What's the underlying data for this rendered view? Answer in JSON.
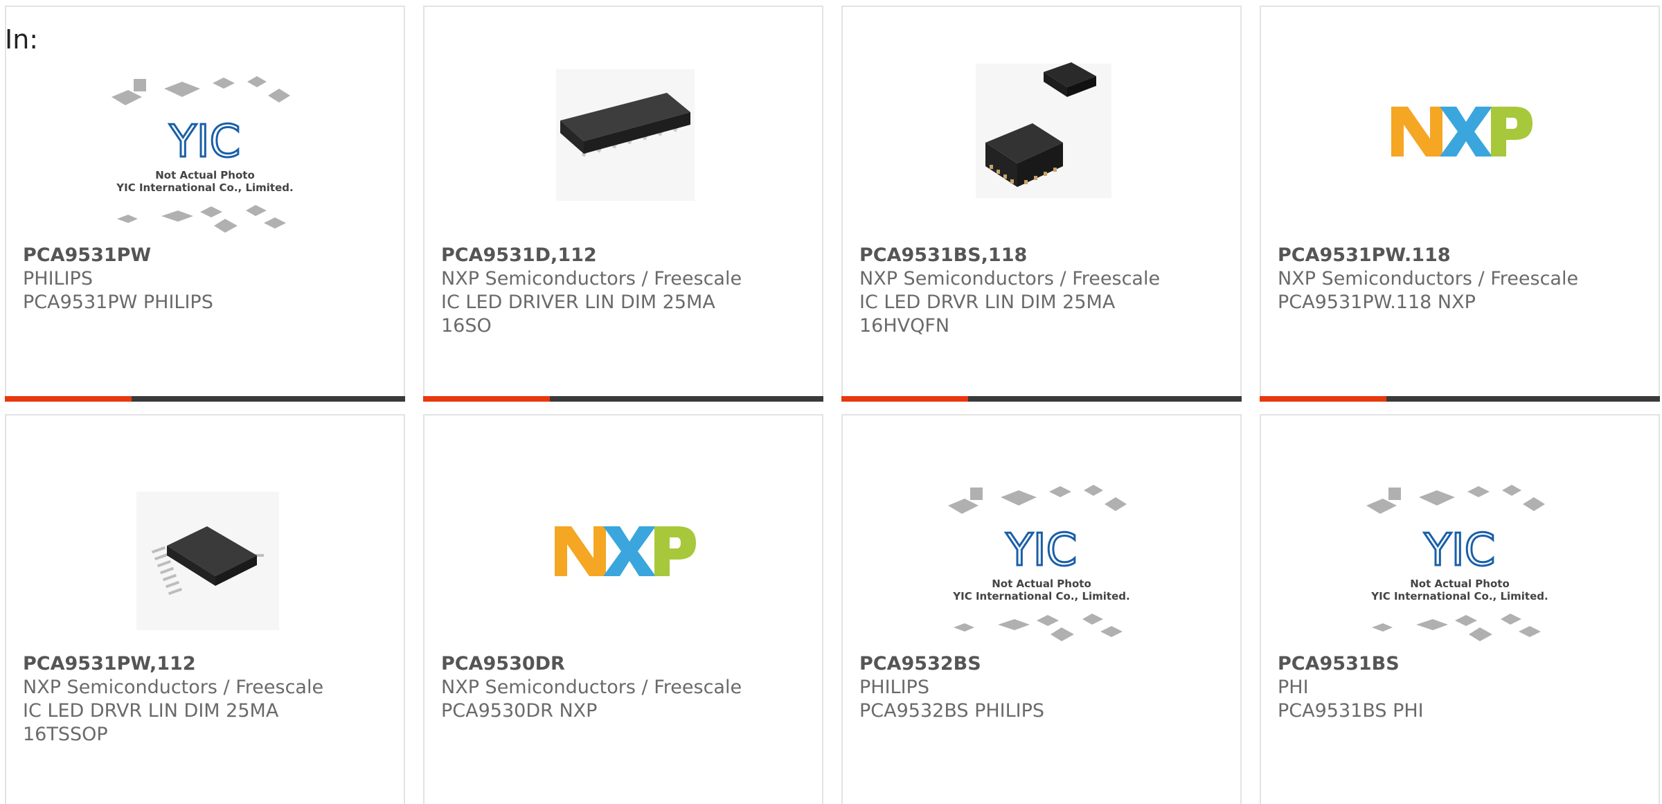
{
  "header": {
    "in_label": "In:"
  },
  "colors": {
    "accent": "#e8380d",
    "bar": "#3a3a3a",
    "border": "#e3e3e3",
    "nxp_orange": "#f5a623",
    "nxp_blue": "#3aa6dd",
    "nxp_green": "#a7c83b"
  },
  "placeholder": {
    "line1": "Not Actual Photo",
    "line2": "YIC International Co., Limited.",
    "logo": "YIC"
  },
  "cards": [
    {
      "part": "PCA9531PW",
      "manufacturer": "PHILIPS",
      "desc1": "PCA9531PW PHILIPS",
      "desc2": "",
      "image": "yic-placeholder"
    },
    {
      "part": "PCA9531D,112",
      "manufacturer": "NXP Semiconductors / Freescale",
      "desc1": "IC LED DRIVER LIN DIM 25MA",
      "desc2": "16SO",
      "image": "so16-chip"
    },
    {
      "part": "PCA9531BS,118",
      "manufacturer": "NXP Semiconductors / Freescale",
      "desc1": "IC LED DRVR LIN DIM 25MA",
      "desc2": "16HVQFN",
      "image": "qfn-chip"
    },
    {
      "part": "PCA9531PW.118",
      "manufacturer": "NXP Semiconductors / Freescale",
      "desc1": "PCA9531PW.118 NXP",
      "desc2": "",
      "image": "nxp-logo"
    },
    {
      "part": "PCA9531PW,112",
      "manufacturer": "NXP Semiconductors / Freescale",
      "desc1": "IC LED DRVR LIN DIM 25MA",
      "desc2": "16TSSOP",
      "image": "tssop-chip"
    },
    {
      "part": "PCA9530DR",
      "manufacturer": "NXP Semiconductors / Freescale",
      "desc1": "PCA9530DR NXP",
      "desc2": "",
      "image": "nxp-logo"
    },
    {
      "part": "PCA9532BS",
      "manufacturer": "PHILIPS",
      "desc1": "PCA9532BS PHILIPS",
      "desc2": "",
      "image": "yic-placeholder"
    },
    {
      "part": "PCA9531BS",
      "manufacturer": "PHI",
      "desc1": "PCA9531BS PHI",
      "desc2": "",
      "image": "yic-placeholder"
    }
  ]
}
